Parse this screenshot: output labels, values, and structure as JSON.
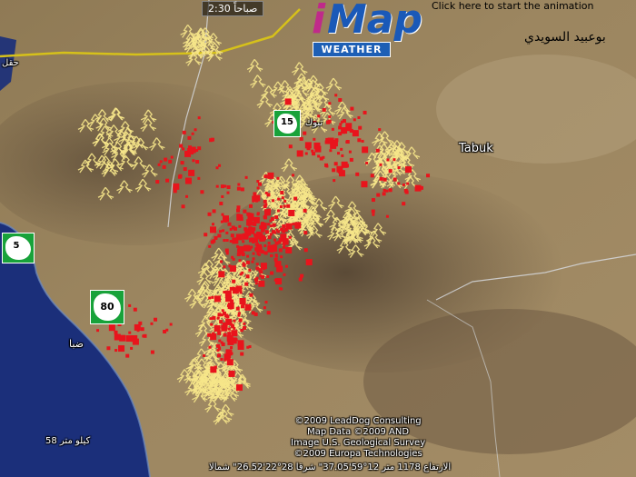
{
  "overlay": {
    "clock": "2:30 صباحاً",
    "animation_link": "Click here to start the animation",
    "author": "بوعبيد السويدي",
    "logo": {
      "i": "i",
      "map": "Map",
      "weather": "WEATHER"
    }
  },
  "places": {
    "tabuk": "Tabuk",
    "tabuk_ar": "تبوك",
    "duba": "ضبا",
    "left_city": "حقل"
  },
  "shields": {
    "north": "15",
    "west": "5",
    "south": "80"
  },
  "credits": [
    "©2009 LeadDog Consulting",
    "Map Data ©2009 AND",
    "Image U.S. Geological Survey",
    "©2009 Europa Technologies"
  ],
  "scale_text": "58 كيلو متر",
  "status_bar": "الارتفاع 1178 متر  12°59'37.05\" شرقا   28°22'26.52\" شمالا",
  "colors": {
    "lightning_strike": "#e8141c",
    "lightning_branch": "#f6e68a",
    "border": "#d9dde3",
    "road": "#d6c11a",
    "sea": "#1b2f7a"
  },
  "icons": [
    "lightning-strike-marker",
    "lightning-branch-marker",
    "road-shield-icon"
  ]
}
